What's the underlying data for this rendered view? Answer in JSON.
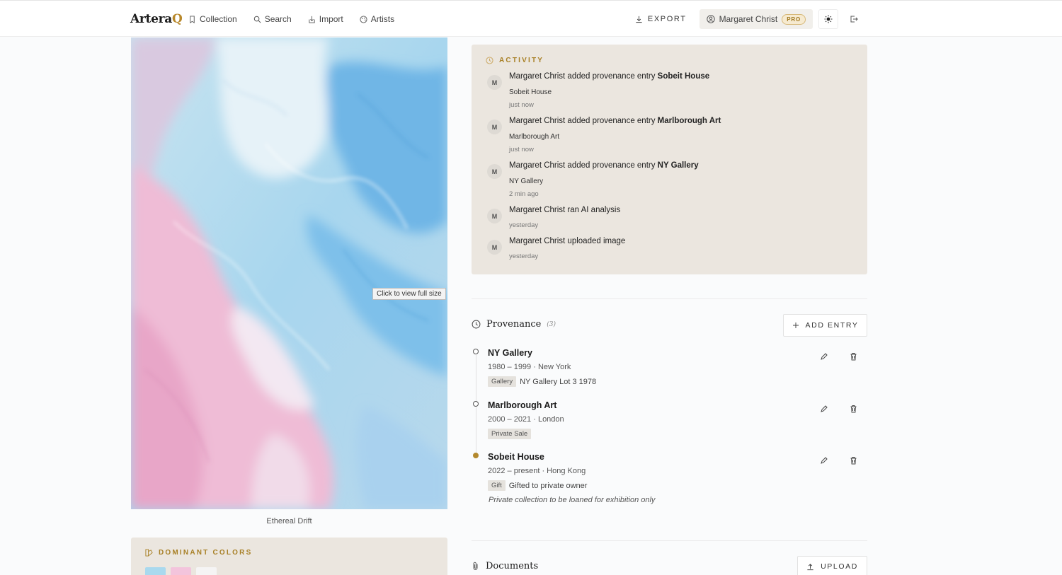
{
  "app": {
    "logo_main": "Artera",
    "logo_accent": "Q"
  },
  "nav": [
    {
      "label": "Collection",
      "icon": "bookmark-icon"
    },
    {
      "label": "Search",
      "icon": "search-icon"
    },
    {
      "label": "Import",
      "icon": "import-icon"
    },
    {
      "label": "Artists",
      "icon": "palette-icon"
    }
  ],
  "header": {
    "export_label": "EXPORT",
    "user_name": "Margaret Christ",
    "plan_badge": "PRO"
  },
  "artwork": {
    "caption": "Ethereal Drift",
    "tooltip": "Click to view full size"
  },
  "dominant_colors": {
    "heading": "DOMINANT COLORS",
    "swatches": [
      "#a9d9ee",
      "#f3c4dc",
      "#f5f4f4"
    ]
  },
  "activity": {
    "heading": "ACTIVITY",
    "items": [
      {
        "avatar": "M",
        "prefix": "Margaret Christ added provenance entry ",
        "bold": "Sobeit House",
        "sub": "Sobeit House",
        "time": "just now"
      },
      {
        "avatar": "M",
        "prefix": "Margaret Christ added provenance entry ",
        "bold": "Marlborough Art",
        "sub": "Marlborough Art",
        "time": "just now"
      },
      {
        "avatar": "M",
        "prefix": "Margaret Christ added provenance entry ",
        "bold": "NY Gallery",
        "sub": "NY Gallery",
        "time": "2 min ago"
      },
      {
        "avatar": "M",
        "prefix": "Margaret Christ ran AI analysis",
        "bold": "",
        "sub": "",
        "time": "yesterday"
      },
      {
        "avatar": "M",
        "prefix": "Margaret Christ uploaded image",
        "bold": "",
        "sub": "",
        "time": "yesterday"
      }
    ]
  },
  "provenance": {
    "title": "Provenance",
    "count": "(3)",
    "add_label": "ADD ENTRY",
    "entries": [
      {
        "name": "NY Gallery",
        "meta": "1980 – 1999 · New York",
        "tag": "Gallery",
        "detail": "NY Gallery Lot 3 1978",
        "note": "",
        "current": false
      },
      {
        "name": "Marlborough Art",
        "meta": "2000 – 2021 · London",
        "tag": "Private Sale",
        "detail": "",
        "note": "",
        "current": false
      },
      {
        "name": "Sobeit House",
        "meta": "2022 – present · Hong Kong",
        "tag": "Gift",
        "detail": "Gifted to private owner",
        "note": "Private collection to be loaned for exhibition only",
        "current": true
      }
    ]
  },
  "documents": {
    "title": "Documents",
    "upload_label": "UPLOAD"
  },
  "colors": {
    "accent": "#b3892e",
    "panel": "#ebe6df"
  }
}
